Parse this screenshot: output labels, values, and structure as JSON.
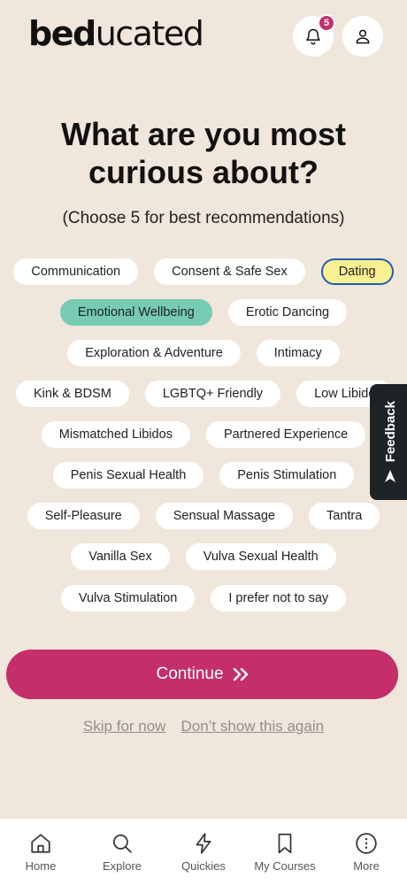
{
  "header": {
    "logo_bold": "bed",
    "logo_light": "ucated",
    "notification_count": "5"
  },
  "main": {
    "title_line1": "What are you most",
    "title_line2": "curious about?",
    "subtitle": "(Choose 5 for best recommendations)"
  },
  "topics": {
    "row1": [
      "Communication",
      "Consent & Safe Sex",
      "Dating"
    ],
    "row2": [
      "Emotional Wellbeing",
      "Erotic Dancing"
    ],
    "row3": [
      "Exploration & Adventure",
      "Intimacy"
    ],
    "row4": [
      "Kink & BDSM",
      "LGBTQ+ Friendly",
      "Low Libido"
    ],
    "row5": [
      "Mismatched Libidos",
      "Partnered Experience"
    ],
    "row6": [
      "Penis Sexual Health",
      "Penis Stimulation"
    ],
    "row7": [
      "Self-Pleasure",
      "Sensual Massage",
      "Tantra"
    ],
    "row8": [
      "Vanilla Sex",
      "Vulva Sexual Health"
    ],
    "row9": [
      "Vulva Stimulation",
      "I prefer not to say"
    ]
  },
  "actions": {
    "continue_label": "Continue",
    "skip_label": "Skip for now",
    "dont_show_label": "Don’t show this again"
  },
  "feedback": {
    "label": "Feedback"
  },
  "nav": {
    "items": [
      {
        "label": "Home",
        "icon": "home-icon"
      },
      {
        "label": "Explore",
        "icon": "search-icon"
      },
      {
        "label": "Quickies",
        "icon": "lightning-icon"
      },
      {
        "label": "My Courses",
        "icon": "bookmark-icon"
      },
      {
        "label": "More",
        "icon": "more-icon"
      }
    ]
  },
  "colors": {
    "background": "#F1E6DC",
    "accent": "#C42E6A",
    "selected_green": "#76CBB2",
    "selected_yellow": "#FBF092",
    "selected_yellow_border": "#1F5FB0",
    "feedback_bg": "#1E2326"
  }
}
